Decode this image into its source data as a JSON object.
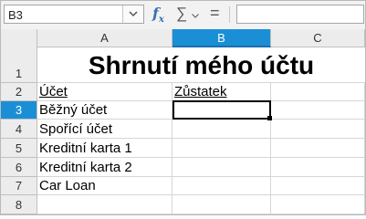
{
  "formula_bar": {
    "name_box": "B3",
    "function_wizard_icon": "fx-icon",
    "sum_icon": "sigma-icon",
    "formula_icon": "equals-icon",
    "formula_value": ""
  },
  "columns": [
    "A",
    "B",
    "C"
  ],
  "active_column": "B",
  "rows": [
    "1",
    "2",
    "3",
    "4",
    "5",
    "6",
    "7",
    "8"
  ],
  "active_row": "3",
  "sheet": {
    "title": "Shrnutí mého účtu",
    "header_account": "Účet",
    "header_balance": "Zůstatek",
    "accounts": [
      "Běžný účet",
      "Spořící účet",
      "Kreditní karta 1",
      "Kreditní karta 2",
      "Car Loan"
    ]
  },
  "colors": {
    "selection_accent": "#1b8fd6",
    "fx_icon": "#3a6fb3"
  }
}
